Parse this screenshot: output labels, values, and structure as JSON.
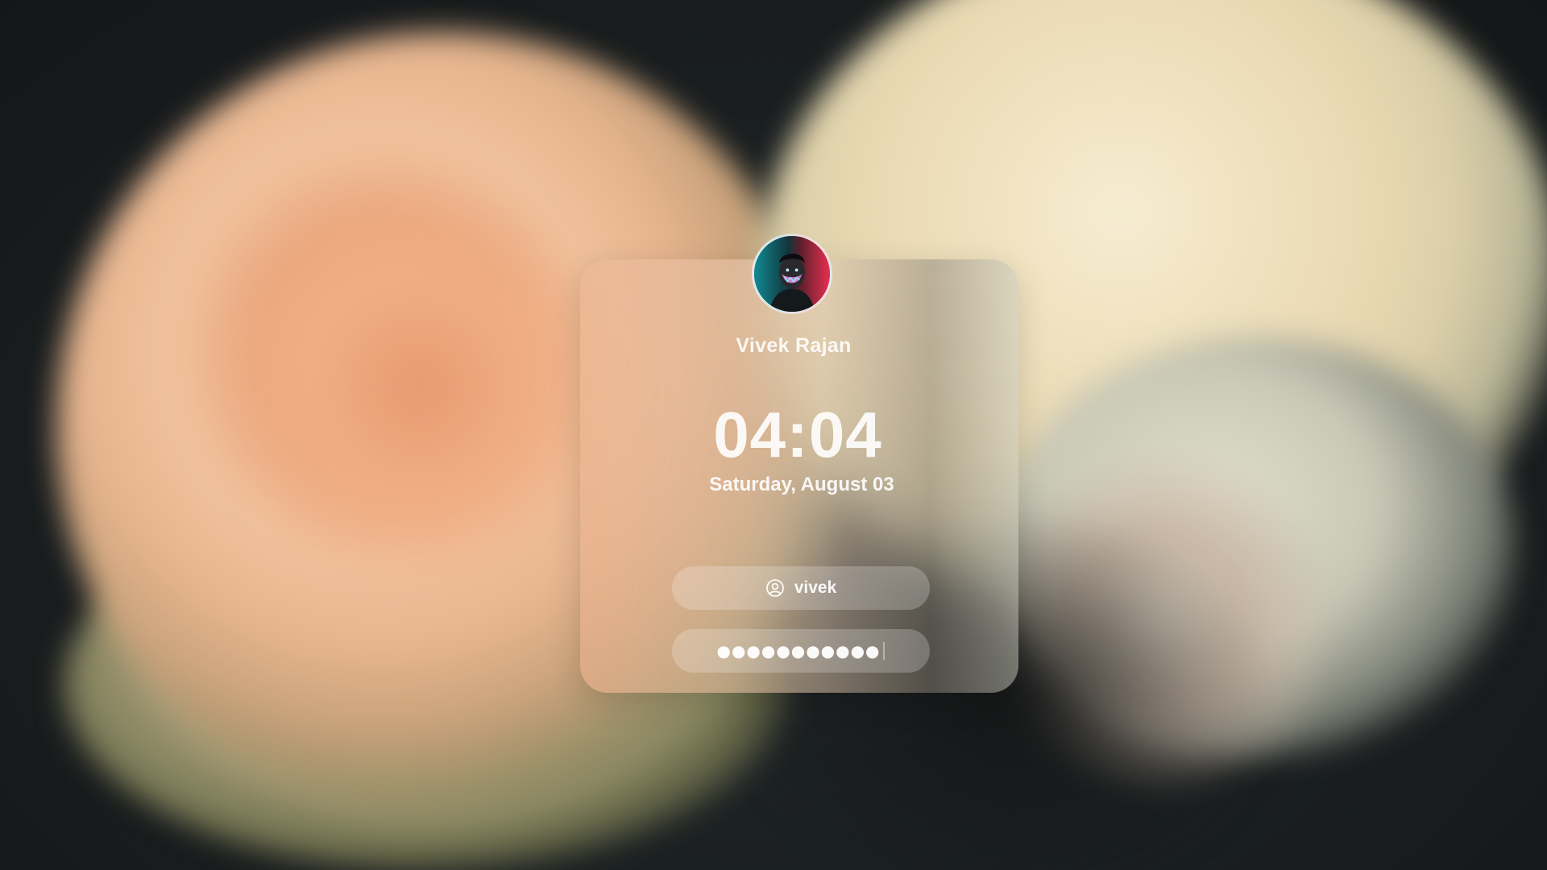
{
  "lock_screen": {
    "user_full_name": "Vivek Rajan",
    "time": "04:04",
    "date": "Saturday, August 03",
    "username": "vivek",
    "password_mask": "●●●●●●●●●●●",
    "avatar_icon": "masked-person-avatar",
    "user_field_icon": "user-circle-icon"
  },
  "colors": {
    "background": "#1b1f20",
    "text": "#ffffff",
    "avatar_left": "#0f7c86",
    "avatar_right": "#e3304e"
  }
}
